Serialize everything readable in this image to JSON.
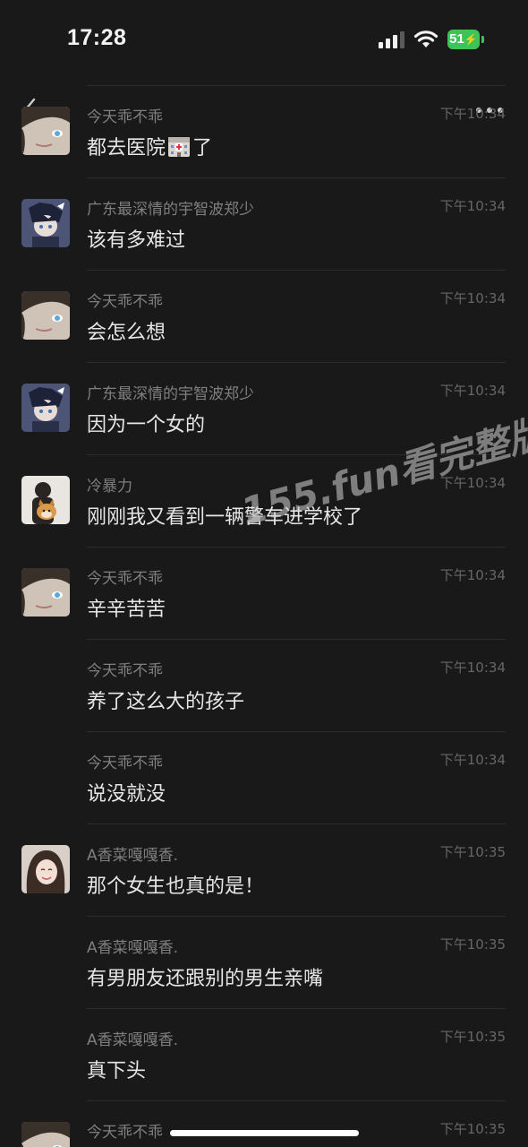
{
  "status_bar": {
    "time": "17:28",
    "battery": "51"
  },
  "watermark": "155.fun看完整版",
  "messages": [
    {
      "sender": "今天乖不乖",
      "time": "下午10:34",
      "text": "都去医院",
      "text_after": "了",
      "avatar": "girl-blue-eye",
      "emoji": "hospital-emoji"
    },
    {
      "sender": "广东最深情的宇智波郑少",
      "time": "下午10:34",
      "text": "该有多难过",
      "avatar": "anime-boy"
    },
    {
      "sender": "今天乖不乖",
      "time": "下午10:34",
      "text": "会怎么想",
      "avatar": "girl-blue-eye"
    },
    {
      "sender": "广东最深情的宇智波郑少",
      "time": "下午10:34",
      "text": "因为一个女的",
      "avatar": "anime-boy"
    },
    {
      "sender": "冷暴力",
      "time": "下午10:34",
      "text": "刚刚我又看到一辆警车进学校了",
      "avatar": "person-with-dog"
    },
    {
      "sender": "今天乖不乖",
      "time": "下午10:34",
      "text": "辛辛苦苦",
      "avatar": "girl-blue-eye"
    },
    {
      "sender": "今天乖不乖",
      "time": "下午10:34",
      "text": "养了这么大的孩子",
      "avatar": ""
    },
    {
      "sender": "今天乖不乖",
      "time": "下午10:34",
      "text": "说没就没",
      "avatar": ""
    },
    {
      "sender": "A香菜嘎嘎香.",
      "time": "下午10:35",
      "text": "那个女生也真的是！",
      "avatar": "smiling-girl"
    },
    {
      "sender": "A香菜嘎嘎香.",
      "time": "下午10:35",
      "text": "有男朋友还跟别的男生亲嘴",
      "avatar": ""
    },
    {
      "sender": "A香菜嘎嘎香.",
      "time": "下午10:35",
      "text": "真下头",
      "avatar": ""
    },
    {
      "sender": "今天乖不乖",
      "time": "下午10:35",
      "text": "",
      "avatar": "girl-blue-eye"
    }
  ],
  "colors": {
    "background": "#191919",
    "sender": "#7f7f7f",
    "time": "#666666",
    "message": "#e6e6e6",
    "battery": "#3dc458"
  }
}
